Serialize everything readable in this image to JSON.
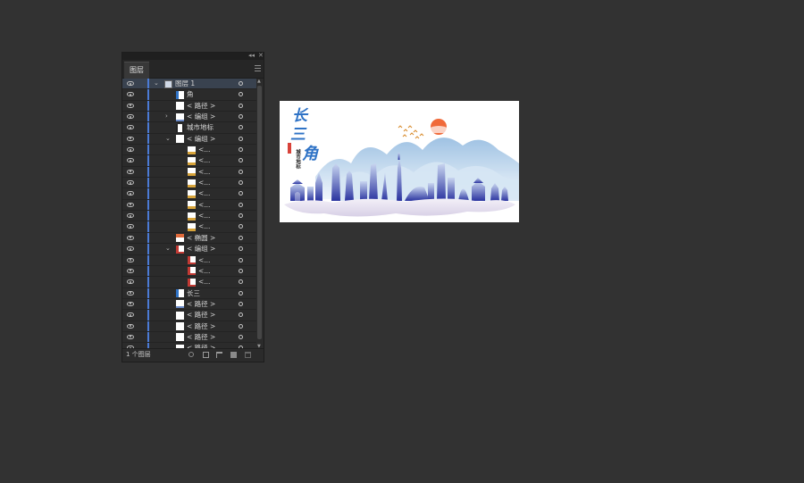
{
  "layers_panel": {
    "tab_label": "图层",
    "footer_count": "1 个图层",
    "rows": [
      {
        "name": "图层 1",
        "indent": 0,
        "twisty": "⌄",
        "thumb": "layer",
        "selected": true
      },
      {
        "name": "角",
        "indent": 2,
        "twisty": "",
        "thumb": "blue-char"
      },
      {
        "name": "< 路径 >",
        "indent": 2,
        "twisty": "",
        "thumb": "blank"
      },
      {
        "name": "< 编组 >",
        "indent": 2,
        "twisty": "›",
        "thumb": "line"
      },
      {
        "name": "城市地标",
        "indent": 2,
        "twisty": "",
        "thumb": "dark-text"
      },
      {
        "name": "< 编组 >",
        "indent": 2,
        "twisty": "⌄",
        "thumb": "blank"
      },
      {
        "name": "<...",
        "indent": 3,
        "twisty": "",
        "thumb": "bird"
      },
      {
        "name": "<...",
        "indent": 3,
        "twisty": "",
        "thumb": "bird"
      },
      {
        "name": "<...",
        "indent": 3,
        "twisty": "",
        "thumb": "bird"
      },
      {
        "name": "<...",
        "indent": 3,
        "twisty": "",
        "thumb": "bird"
      },
      {
        "name": "<...",
        "indent": 3,
        "twisty": "",
        "thumb": "bird"
      },
      {
        "name": "<...",
        "indent": 3,
        "twisty": "",
        "thumb": "bird"
      },
      {
        "name": "<...",
        "indent": 3,
        "twisty": "",
        "thumb": "bird"
      },
      {
        "name": "<...",
        "indent": 3,
        "twisty": "",
        "thumb": "bird"
      },
      {
        "name": "< 椭圆 >",
        "indent": 2,
        "twisty": "",
        "thumb": "sun"
      },
      {
        "name": "< 编组 >",
        "indent": 2,
        "twisty": "⌄",
        "thumb": "red-seal"
      },
      {
        "name": "<...",
        "indent": 3,
        "twisty": "",
        "thumb": "red-seal"
      },
      {
        "name": "<...",
        "indent": 3,
        "twisty": "",
        "thumb": "red-seal"
      },
      {
        "name": "<...",
        "indent": 3,
        "twisty": "",
        "thumb": "red-seal"
      },
      {
        "name": "长三",
        "indent": 2,
        "twisty": "",
        "thumb": "blue-char"
      },
      {
        "name": "< 路径 >",
        "indent": 2,
        "twisty": "",
        "thumb": "line"
      },
      {
        "name": "< 路径 >",
        "indent": 2,
        "twisty": "",
        "thumb": "blank"
      },
      {
        "name": "< 路径 >",
        "indent": 2,
        "twisty": "",
        "thumb": "blank"
      },
      {
        "name": "< 路径 >",
        "indent": 2,
        "twisty": "",
        "thumb": "blank"
      },
      {
        "name": "< 路径 >",
        "indent": 2,
        "twisty": "",
        "thumb": "blank"
      }
    ]
  },
  "artboard": {
    "title_chars": [
      "长",
      "三",
      "角"
    ],
    "subtitle": "城市地标",
    "colors": {
      "title_blue": "#2f73c6",
      "city_blue": "#2f3fa8",
      "mountain": "#bcd7ee",
      "sun": "#f06a3a",
      "seal": "#d8433a",
      "cloud": "#e6e1ef"
    }
  }
}
